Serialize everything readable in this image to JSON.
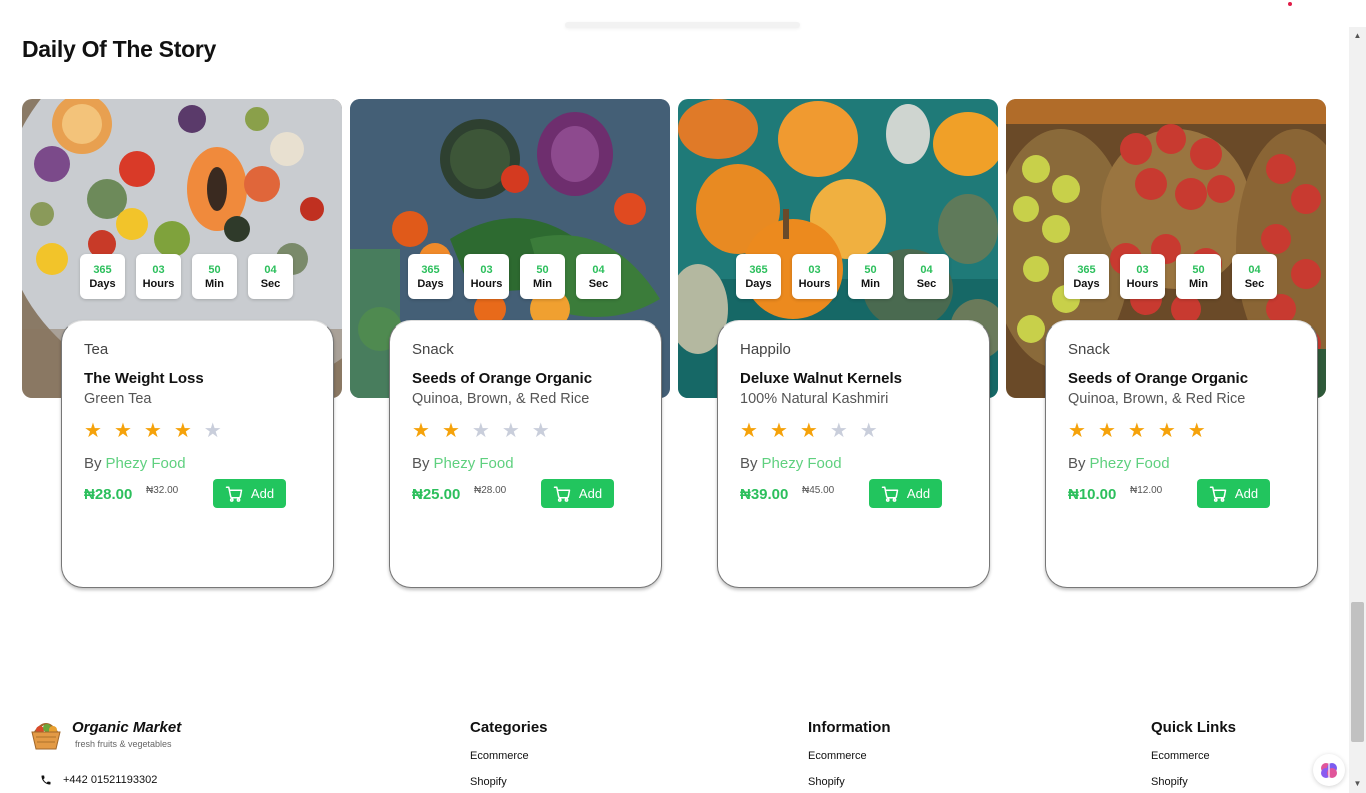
{
  "section": {
    "title": "Daily Of The Story"
  },
  "colors": {
    "accent": "#22c55e",
    "price": "#2cbf5c",
    "star_on": "#f5a20a",
    "star_off": "#c9cedb",
    "brand_link": "#5fd07f",
    "indicator": "#e11d48"
  },
  "cards": [
    {
      "image_icon": "vegetables-platter-image",
      "countdown": [
        {
          "num": "365",
          "label": "Days"
        },
        {
          "num": "03",
          "label": "Hours"
        },
        {
          "num": "50",
          "label": "Min"
        },
        {
          "num": "04",
          "label": "Sec"
        }
      ],
      "category": "Tea",
      "name": "The Weight Loss",
      "subtitle": "Green Tea",
      "rating": 4,
      "by_label": "By",
      "brand": "Phezy Food",
      "price": "₦28.00",
      "old_price": "₦32.00",
      "add_label": "Add"
    },
    {
      "image_icon": "vegetables-table-image",
      "countdown": [
        {
          "num": "365",
          "label": "Days"
        },
        {
          "num": "03",
          "label": "Hours"
        },
        {
          "num": "50",
          "label": "Min"
        },
        {
          "num": "04",
          "label": "Sec"
        }
      ],
      "category": "Snack",
      "name": "Seeds of Orange Organic",
      "subtitle": "Quinoa, Brown, & Red Rice",
      "rating": 2,
      "by_label": "By",
      "brand": "Phezy Food",
      "price": "₦25.00",
      "old_price": "₦28.00",
      "add_label": "Add"
    },
    {
      "image_icon": "pumpkins-image",
      "countdown": [
        {
          "num": "365",
          "label": "Days"
        },
        {
          "num": "03",
          "label": "Hours"
        },
        {
          "num": "50",
          "label": "Min"
        },
        {
          "num": "04",
          "label": "Sec"
        }
      ],
      "category": "Happilo",
      "name": "Deluxe Walnut Kernels",
      "subtitle": "100% Natural Kashmiri",
      "rating": 3,
      "by_label": "By",
      "brand": "Phezy Food",
      "price": "₦39.00",
      "old_price": "₦45.00",
      "add_label": "Add"
    },
    {
      "image_icon": "apple-baskets-image",
      "countdown": [
        {
          "num": "365",
          "label": "Days"
        },
        {
          "num": "03",
          "label": "Hours"
        },
        {
          "num": "50",
          "label": "Min"
        },
        {
          "num": "04",
          "label": "Sec"
        }
      ],
      "category": "Snack",
      "name": "Seeds of Orange Organic",
      "subtitle": "Quinoa, Brown, & Red Rice",
      "rating": 5,
      "by_label": "By",
      "brand": "Phezy Food",
      "price": "₦10.00",
      "old_price": "₦12.00",
      "add_label": "Add"
    }
  ],
  "footer": {
    "brand_name": "Organic Market",
    "tagline": "fresh fruits & vegetables",
    "phone": "+442 01521193302",
    "columns": [
      {
        "title": "Categories",
        "links": [
          "Ecommerce",
          "Shopify"
        ]
      },
      {
        "title": "Information",
        "links": [
          "Ecommerce",
          "Shopify"
        ]
      },
      {
        "title": "Quick Links",
        "links": [
          "Ecommerce",
          "Shopify"
        ]
      }
    ]
  }
}
